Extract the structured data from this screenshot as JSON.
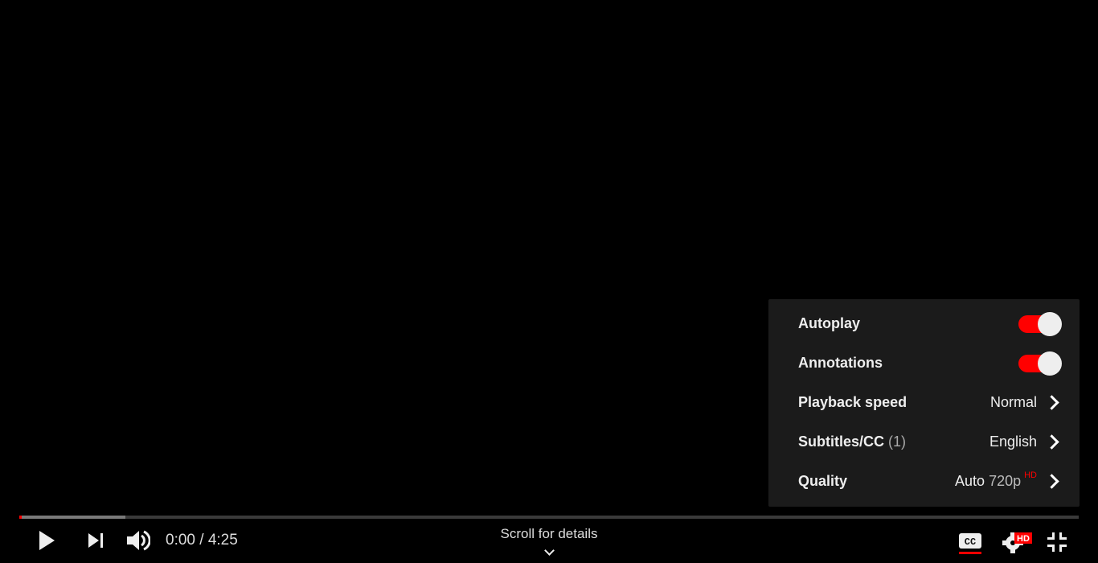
{
  "player": {
    "progress": {
      "played_fraction": 0.002,
      "buffered_fraction": 0.1
    },
    "time": {
      "current": "0:00",
      "separator": " / ",
      "duration": "4:25"
    },
    "scroll_hint": "Scroll for details",
    "controls": {
      "play": "play-icon",
      "next": "next-icon",
      "volume": "volume-icon",
      "captions": "cc-icon",
      "settings": "gear-icon",
      "settings_badge": "HD",
      "exit_fullscreen": "exit-fullscreen-icon"
    },
    "captions_enabled": true,
    "colors": {
      "accent": "#ff0000",
      "menu_bg": "#1c1c1c",
      "track": "#3a3a3a",
      "buffer": "#7a7a7a"
    }
  },
  "settings_menu": {
    "items": [
      {
        "label": "Autoplay",
        "type": "toggle",
        "on": true
      },
      {
        "label": "Annotations",
        "type": "toggle",
        "on": true
      },
      {
        "label": "Playback speed",
        "type": "submenu",
        "value": "Normal"
      },
      {
        "label": "Subtitles/CC",
        "count": "(1)",
        "type": "submenu",
        "value": "English"
      },
      {
        "label": "Quality",
        "type": "submenu",
        "value": "Auto",
        "value_sub": "720p",
        "value_badge": "HD"
      }
    ]
  }
}
